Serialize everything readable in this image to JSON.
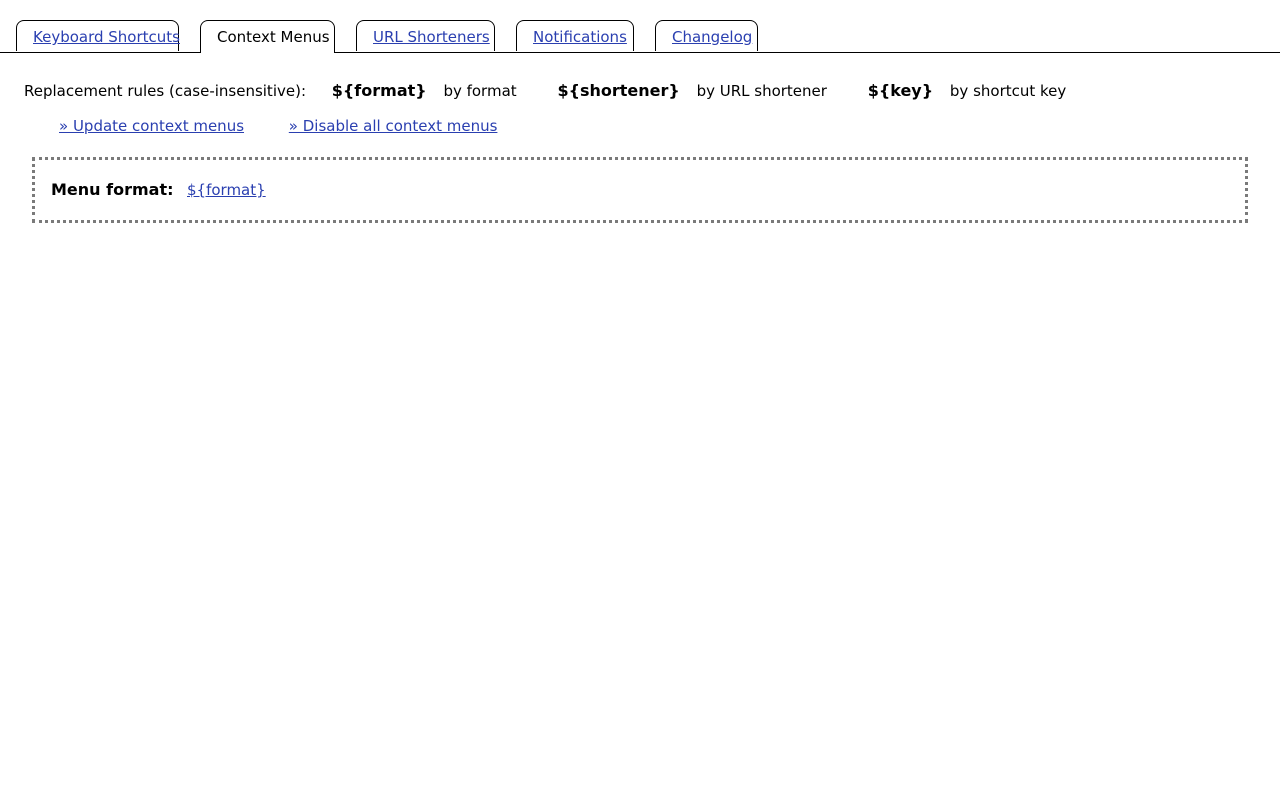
{
  "tabs": [
    {
      "label": "Keyboard Shortcuts",
      "active": false
    },
    {
      "label": "Context Menus",
      "active": true
    },
    {
      "label": "URL Shorteners",
      "active": false
    },
    {
      "label": "Notifications",
      "active": false
    },
    {
      "label": "Changelog",
      "active": false
    }
  ],
  "rules": {
    "intro": "Replacement rules (case-insensitive):",
    "items": [
      {
        "token": "${format}",
        "desc": "by format"
      },
      {
        "token": "${shortener}",
        "desc": "by URL shortener"
      },
      {
        "token": "${key}",
        "desc": "by shortcut key"
      }
    ]
  },
  "actions": {
    "update": "» Update context menus",
    "disable": "» Disable all context menus"
  },
  "menu": {
    "label": "Menu format:",
    "value": "${format}"
  },
  "colors": {
    "link": "#2a3fb0",
    "box_border": "#7a7a7a"
  }
}
